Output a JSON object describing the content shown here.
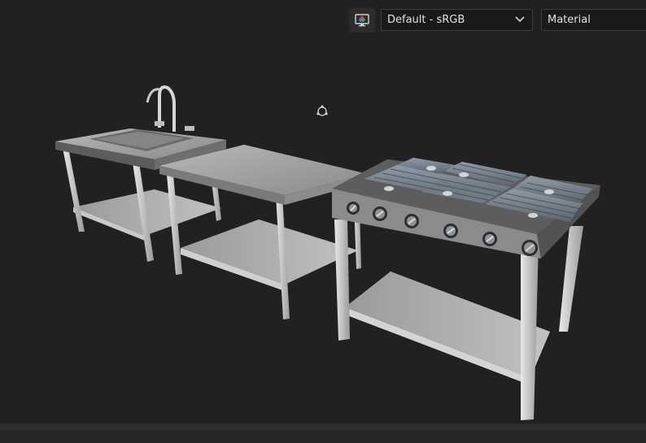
{
  "toolbar": {
    "display_icon": "display-settings-icon",
    "colorspace_value": "Default - sRGB",
    "mode_value": "Material"
  },
  "viewport": {
    "gizmo_icon": "camera-pivot-icon",
    "objects": [
      "sink-table",
      "prep-table",
      "stove-range"
    ]
  },
  "colors": {
    "background": "#212121",
    "toolbar_button": "#2c2c2c",
    "dropdown_bg": "#1a1a1a",
    "dropdown_border": "#3d3d3d",
    "text": "#e0e0e0"
  }
}
